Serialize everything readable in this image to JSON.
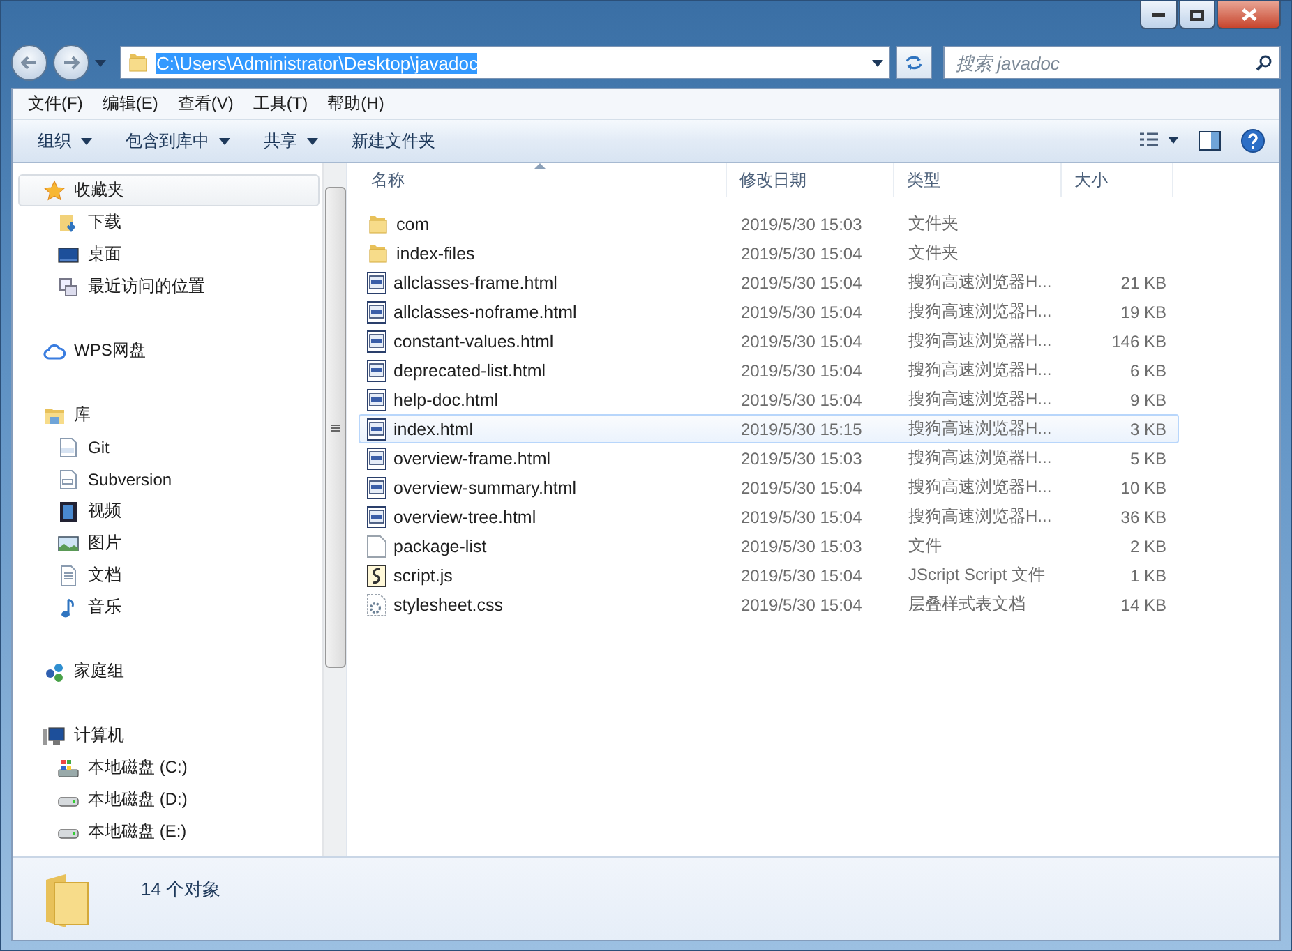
{
  "address": {
    "path": "C:\\Users\\Administrator\\Desktop\\javadoc",
    "selected": true
  },
  "search": {
    "placeholder": "搜索 javadoc"
  },
  "menu": [
    "文件(F)",
    "编辑(E)",
    "查看(V)",
    "工具(T)",
    "帮助(H)"
  ],
  "toolbar": [
    {
      "label": "组织",
      "dropdown": true
    },
    {
      "label": "包含到库中",
      "dropdown": true
    },
    {
      "label": "共享",
      "dropdown": true
    },
    {
      "label": "新建文件夹",
      "dropdown": false
    }
  ],
  "sidebar": [
    {
      "label": "收藏夹",
      "kind": "star",
      "selected": true,
      "children": [
        {
          "label": "下载",
          "kind": "download",
          "selected": false
        },
        {
          "label": "桌面",
          "kind": "desktop",
          "selected": false
        },
        {
          "label": "最近访问的位置",
          "kind": "recent",
          "selected": false
        }
      ]
    },
    {
      "label": "WPS网盘",
      "kind": "cloud",
      "selected": false
    },
    {
      "label": "库",
      "kind": "library",
      "selected": false,
      "children": [
        {
          "label": "Git",
          "kind": "git",
          "selected": false
        },
        {
          "label": "Subversion",
          "kind": "svn",
          "selected": false
        },
        {
          "label": "视频",
          "kind": "video",
          "selected": false
        },
        {
          "label": "图片",
          "kind": "picture",
          "selected": false
        },
        {
          "label": "文档",
          "kind": "document",
          "selected": false
        },
        {
          "label": "音乐",
          "kind": "music",
          "selected": false
        }
      ]
    },
    {
      "label": "家庭组",
      "kind": "homegroup",
      "selected": false
    },
    {
      "label": "计算机",
      "kind": "computer",
      "selected": false,
      "children": [
        {
          "label": "本地磁盘 (C:)",
          "kind": "system-disk",
          "selected": false
        },
        {
          "label": "本地磁盘 (D:)",
          "kind": "disk",
          "selected": false
        },
        {
          "label": "本地磁盘 (E:)",
          "kind": "disk",
          "selected": false
        }
      ]
    }
  ],
  "columns": [
    {
      "label": "名称",
      "sorted": true
    },
    {
      "label": "修改日期",
      "sorted": false
    },
    {
      "label": "类型",
      "sorted": false
    },
    {
      "label": "大小",
      "sorted": false
    }
  ],
  "files": [
    {
      "name": "com",
      "date": "2019/5/30 15:03",
      "type": "文件夹",
      "kind": "folder",
      "selected": false
    },
    {
      "name": "index-files",
      "date": "2019/5/30 15:04",
      "type": "文件夹",
      "kind": "folder",
      "selected": false
    },
    {
      "name": "allclasses-frame.html",
      "date": "2019/5/30 15:04",
      "type": "搜狗高速浏览器H...",
      "size": "21 KB",
      "kind": "html",
      "selected": false
    },
    {
      "name": "allclasses-noframe.html",
      "date": "2019/5/30 15:04",
      "type": "搜狗高速浏览器H...",
      "size": "19 KB",
      "kind": "html",
      "selected": false
    },
    {
      "name": "constant-values.html",
      "date": "2019/5/30 15:04",
      "type": "搜狗高速浏览器H...",
      "size": "146 KB",
      "kind": "html",
      "selected": false
    },
    {
      "name": "deprecated-list.html",
      "date": "2019/5/30 15:04",
      "type": "搜狗高速浏览器H...",
      "size": "6 KB",
      "kind": "html",
      "selected": false
    },
    {
      "name": "help-doc.html",
      "date": "2019/5/30 15:04",
      "type": "搜狗高速浏览器H...",
      "size": "9 KB",
      "kind": "html",
      "selected": false
    },
    {
      "name": "index.html",
      "date": "2019/5/30 15:15",
      "type": "搜狗高速浏览器H...",
      "size": "3 KB",
      "kind": "html",
      "selected": true
    },
    {
      "name": "overview-frame.html",
      "date": "2019/5/30 15:03",
      "type": "搜狗高速浏览器H...",
      "size": "5 KB",
      "kind": "html",
      "selected": false
    },
    {
      "name": "overview-summary.html",
      "date": "2019/5/30 15:04",
      "type": "搜狗高速浏览器H...",
      "size": "10 KB",
      "kind": "html",
      "selected": false
    },
    {
      "name": "overview-tree.html",
      "date": "2019/5/30 15:04",
      "type": "搜狗高速浏览器H...",
      "size": "36 KB",
      "kind": "html",
      "selected": false
    },
    {
      "name": "package-list",
      "date": "2019/5/30 15:03",
      "type": "文件",
      "size": "2 KB",
      "kind": "file",
      "selected": false
    },
    {
      "name": "script.js",
      "date": "2019/5/30 15:04",
      "type": "JScript Script 文件",
      "size": "1 KB",
      "kind": "script",
      "selected": false
    },
    {
      "name": "stylesheet.css",
      "date": "2019/5/30 15:04",
      "type": "层叠样式表文档",
      "size": "14 KB",
      "kind": "css",
      "selected": false
    }
  ],
  "status": {
    "count": "14 个对象"
  }
}
